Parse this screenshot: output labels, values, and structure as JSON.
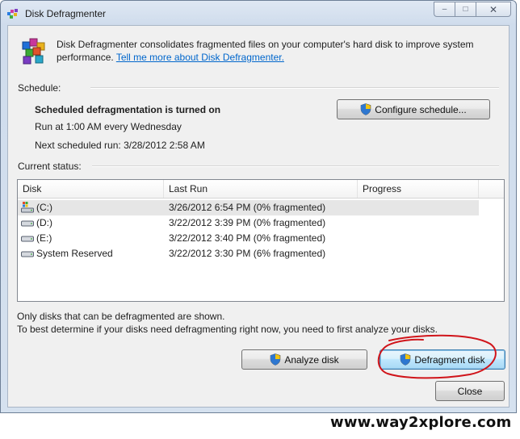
{
  "window": {
    "title": "Disk Defragmenter",
    "app_icon": "disk-defragmenter-icon",
    "caption_buttons": {
      "minimize": "–",
      "maximize": "□",
      "close": "✕"
    }
  },
  "intro": {
    "icon": "defrag-blocks-icon",
    "text_line1": "Disk Defragmenter consolidates fragmented files on your computer's hard disk to improve system",
    "text_line2_prefix": "performance.",
    "link": "Tell me more about Disk Defragmenter."
  },
  "schedule": {
    "heading": "Schedule:",
    "status": "Scheduled defragmentation is turned on",
    "run_at": "Run at 1:00 AM every Wednesday",
    "next_run": "Next scheduled run: 3/28/2012 2:58 AM",
    "configure_button": "Configure schedule..."
  },
  "current_status": {
    "heading": "Current status:",
    "columns": [
      "Disk",
      "Last Run",
      "Progress"
    ],
    "rows": [
      {
        "disk": "(C:)",
        "icon": "system-drive-icon",
        "last_run": "3/26/2012 6:54 PM (0% fragmented)",
        "progress": "",
        "selected": true
      },
      {
        "disk": "(D:)",
        "icon": "drive-icon",
        "last_run": "3/22/2012 3:39 PM (0% fragmented)",
        "progress": "",
        "selected": false
      },
      {
        "disk": "(E:)",
        "icon": "drive-icon",
        "last_run": "3/22/2012 3:40 PM (0% fragmented)",
        "progress": "",
        "selected": false
      },
      {
        "disk": "System Reserved",
        "icon": "drive-icon",
        "last_run": "3/22/2012 3:30 PM (6% fragmented)",
        "progress": "",
        "selected": false
      }
    ]
  },
  "notes": {
    "line1": "Only disks that can be defragmented are shown.",
    "line2": "To best determine if your disks need defragmenting right now, you need to first analyze your disks."
  },
  "buttons": {
    "analyze": "Analyze disk",
    "defragment": "Defragment disk",
    "close": "Close"
  },
  "annotation_color": "#d0141a",
  "watermark": "www.way2xplore.com"
}
